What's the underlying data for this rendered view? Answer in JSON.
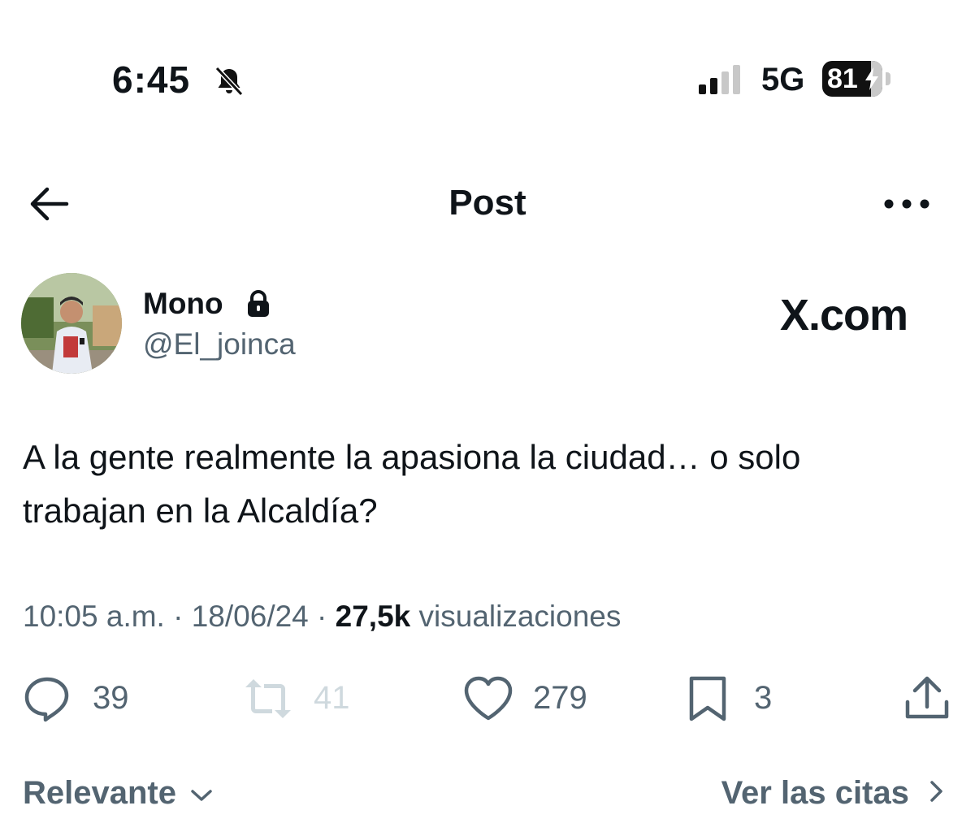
{
  "status_bar": {
    "time": "6:45",
    "network": "5G",
    "battery_percent": "81",
    "battery_level": 0.81,
    "icons": [
      "bell-slash-icon",
      "signal-bars-icon",
      "battery-charging-icon"
    ]
  },
  "header": {
    "title": "Post",
    "icons": [
      "back-arrow-icon",
      "more-dots-icon"
    ]
  },
  "author": {
    "name": "Mono",
    "handle": "@El_joinca",
    "icons": [
      "lock-icon"
    ]
  },
  "watermark": "X.com",
  "post": {
    "text_line1": "A la gente realmente la apasiona la ciudad… o solo",
    "text_line2": "trabajan en la Alcaldía?",
    "time": "10:05 a.m.",
    "date": "18/06/24",
    "separator": "·",
    "views_count": "27,5k",
    "views_label": "visualizaciones"
  },
  "actions": {
    "replies": "39",
    "reposts": "41",
    "likes": "279",
    "bookmarks": "3",
    "icons": [
      "reply-icon",
      "repost-icon",
      "like-icon",
      "bookmark-icon",
      "share-icon"
    ]
  },
  "footer": {
    "sort_label": "Relevante",
    "quotes_label": "Ver las citas"
  },
  "colors": {
    "text_primary": "#0f1419",
    "text_secondary": "#536471",
    "disabled": "#cfd9de"
  }
}
